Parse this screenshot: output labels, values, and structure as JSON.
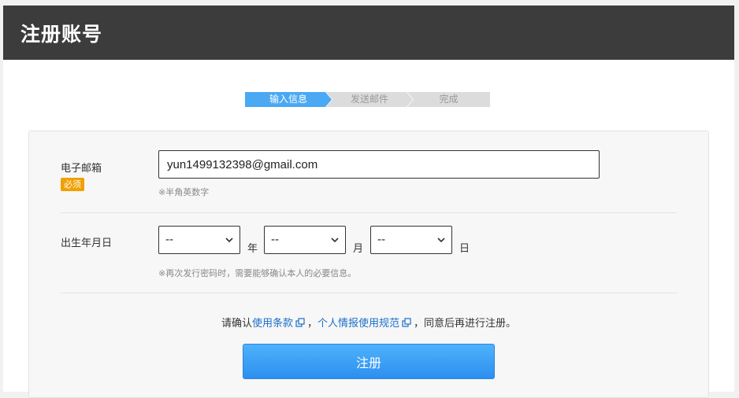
{
  "header": {
    "title": "注册账号"
  },
  "steps": [
    {
      "label": "输入信息",
      "active": true
    },
    {
      "label": "发送邮件",
      "active": false
    },
    {
      "label": "完成",
      "active": false
    }
  ],
  "email": {
    "label": "电子邮箱",
    "required_badge": "必须",
    "value": "yun1499132398@gmail.com",
    "hint": "※半角英数字"
  },
  "birth": {
    "label": "出生年月日",
    "year": {
      "selected": "--",
      "unit": "年"
    },
    "month": {
      "selected": "--",
      "unit": "月"
    },
    "day": {
      "selected": "--",
      "unit": "日"
    },
    "hint": "※再次发行密码时，需要能够确认本人的必要信息。"
  },
  "agreement": {
    "prefix": "请确认",
    "terms_link": "使用条款",
    "separator": "，",
    "privacy_link": "个人情报使用规范",
    "suffix": "，同意后再进行注册。"
  },
  "submit_label": "注册",
  "colors": {
    "header_bg": "#3c3c3c",
    "active_step": "#4ba9f3",
    "badge": "#f0a000",
    "link": "#1a6fc9",
    "button": "#2c8ff0"
  }
}
